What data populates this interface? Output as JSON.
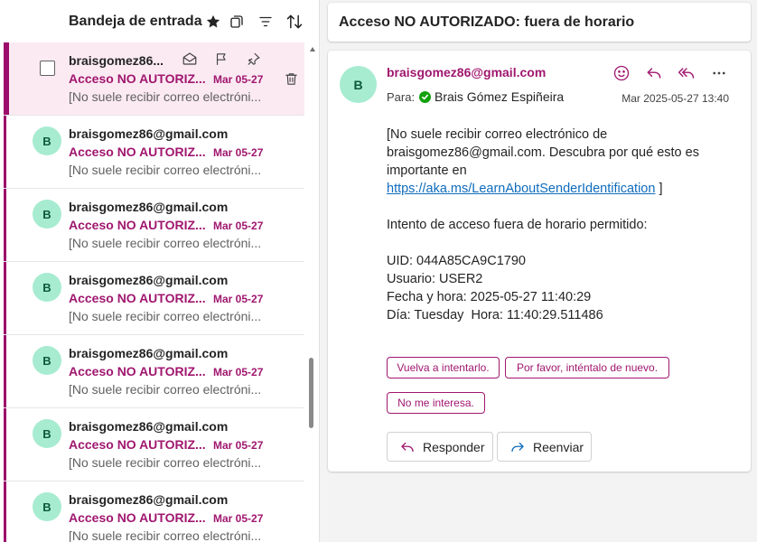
{
  "colors": {
    "accent": "#9c0c6b",
    "accent_text": "#a0176f",
    "avatar_bg": "#a7ecd0",
    "selected_row_bg": "#fbeaf2",
    "link": "#0f6cbd",
    "verified_green": "#13a10e"
  },
  "list": {
    "title": "Bandeja de entrada",
    "header_icons": [
      "star-icon",
      "copy-icon",
      "filter-icon",
      "sort-icon"
    ],
    "messages": [
      {
        "avatar": "B",
        "sender": "braisgomez86...",
        "subject": "Acceso NO AUTORIZ...",
        "date": "Mar 05-27",
        "preview": "[No suele recibir correo electróni...",
        "selected": true
      },
      {
        "avatar": "B",
        "sender": "braisgomez86@gmail.com",
        "subject": "Acceso NO AUTORIZ...",
        "date": "Mar 05-27",
        "preview": "[No suele recibir correo electróni..."
      },
      {
        "avatar": "B",
        "sender": "braisgomez86@gmail.com",
        "subject": "Acceso NO AUTORIZ...",
        "date": "Mar 05-27",
        "preview": "[No suele recibir correo electróni..."
      },
      {
        "avatar": "B",
        "sender": "braisgomez86@gmail.com",
        "subject": "Acceso NO AUTORIZ...",
        "date": "Mar 05-27",
        "preview": "[No suele recibir correo electróni..."
      },
      {
        "avatar": "B",
        "sender": "braisgomez86@gmail.com",
        "subject": "Acceso NO AUTORIZ...",
        "date": "Mar 05-27",
        "preview": "[No suele recibir correo electróni..."
      },
      {
        "avatar": "B",
        "sender": "braisgomez86@gmail.com",
        "subject": "Acceso NO AUTORIZ...",
        "date": "Mar 05-27",
        "preview": "[No suele recibir correo electróni..."
      },
      {
        "avatar": "B",
        "sender": "braisgomez86@gmail.com",
        "subject": "Acceso NO AUTORIZ...",
        "date": "Mar 05-27",
        "preview": "[No suele recibir correo electróni..."
      }
    ]
  },
  "reading": {
    "subject": "Acceso NO AUTORIZADO: fuera de horario",
    "avatar": "B",
    "from": "braisgomez86@gmail.com",
    "to_label": "Para:",
    "to_name": "Brais Gómez Espiñeira",
    "date": "Mar 2025-05-27 13:40",
    "body": {
      "notice_lines": [
        "[No suele recibir correo electrónico de",
        "braisgomez86@gmail.com. Descubra por qué esto es",
        "importante en"
      ],
      "link": "https://aka.ms/LearnAboutSenderIdentification",
      "link_suffix": " ]",
      "intro": "Intento de acceso fuera de horario permitido:",
      "uid": "UID: 044A85CA9C1790",
      "user": "Usuario: USER2",
      "datetime": "Fecha y hora: 2025-05-27 11:40:29",
      "day_time": "Día: Tuesday  Hora: 11:40:29.511486"
    },
    "suggestions": [
      "Vuelva a intentarlo.",
      "Por favor, inténtalo de nuevo.",
      "No me interesa."
    ],
    "reply_label": "Responder",
    "forward_label": "Reenviar"
  }
}
